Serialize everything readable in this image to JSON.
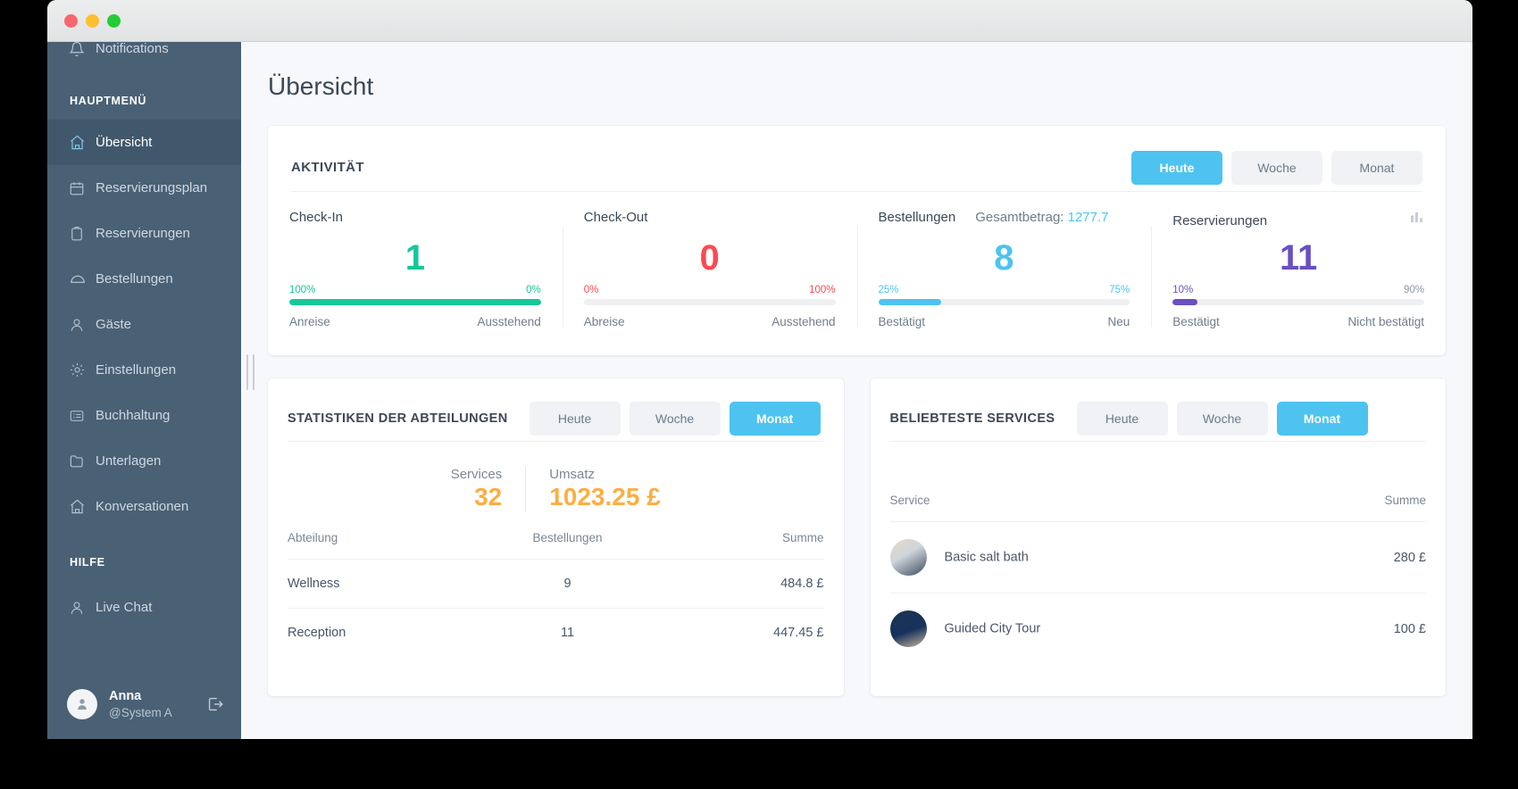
{
  "window": {
    "traffic_lights": [
      "close",
      "minimize",
      "maximize"
    ]
  },
  "sidebar": {
    "partial_item": {
      "label": "Notifications",
      "icon": "bell-icon"
    },
    "sections": [
      {
        "label": "HAUPTMENÜ",
        "items": [
          {
            "label": "Übersicht",
            "icon": "home-icon",
            "active": true
          },
          {
            "label": "Reservierungsplan",
            "icon": "calendar-icon",
            "active": false
          },
          {
            "label": "Reservierungen",
            "icon": "clipboard-icon",
            "active": false
          },
          {
            "label": "Bestellungen",
            "icon": "room-service-icon",
            "active": false
          },
          {
            "label": "Gäste",
            "icon": "user-icon",
            "active": false
          },
          {
            "label": "Einstellungen",
            "icon": "gear-icon",
            "active": false
          },
          {
            "label": "Buchhaltung",
            "icon": "list-card-icon",
            "active": false
          },
          {
            "label": "Unterlagen",
            "icon": "folder-icon",
            "active": false
          },
          {
            "label": "Konversationen",
            "icon": "home-outline-icon",
            "active": false
          }
        ]
      },
      {
        "label": "HILFE",
        "items": [
          {
            "label": "Live Chat",
            "icon": "user-icon",
            "active": false
          }
        ]
      }
    ],
    "user": {
      "name": "Anna",
      "handle": "@System A",
      "avatar_icon": "avatar-icon",
      "logout_icon": "logout-icon"
    }
  },
  "page": {
    "title": "Übersicht"
  },
  "activity": {
    "title": "AKTIVITÄT",
    "tabs": [
      {
        "label": "Heute",
        "selected": true
      },
      {
        "label": "Woche",
        "selected": false
      },
      {
        "label": "Monat",
        "selected": false
      }
    ],
    "chart_icon": "bar-chart-icon",
    "stats": [
      {
        "name": "Check-In",
        "value": "1",
        "color": "#16c79a",
        "left_pct": "100%",
        "right_pct": "0%",
        "fill": 100,
        "left_label": "Anreise",
        "right_label": "Ausstehend"
      },
      {
        "name": "Check-Out",
        "value": "0",
        "color": "#fc4a51",
        "left_pct": "0%",
        "right_pct": "100%",
        "fill": 0,
        "left_label": "Abreise",
        "right_label": "Ausstehend"
      },
      {
        "name": "Bestellungen",
        "extra_label": "Gesamtbetrag:",
        "extra_value": "1277.7",
        "value": "8",
        "color": "#4ec3f0",
        "left_pct": "25%",
        "right_pct": "75%",
        "fill": 25,
        "left_label": "Bestätigt",
        "right_label": "Neu"
      },
      {
        "name": "Reservierungen",
        "value": "11",
        "color": "#6a4fc1",
        "left_pct": "10%",
        "right_pct": "90%",
        "fill": 10,
        "left_label": "Bestätigt",
        "right_label": "Nicht bestätigt"
      }
    ]
  },
  "departments": {
    "title": "STATISTIKEN DER ABTEILUNGEN",
    "tabs": [
      {
        "label": "Heute",
        "selected": false
      },
      {
        "label": "Woche",
        "selected": false
      },
      {
        "label": "Monat",
        "selected": true
      }
    ],
    "totals": [
      {
        "caption": "Services",
        "value": "32"
      },
      {
        "caption": "Umsatz",
        "value": "1023.25 £"
      }
    ],
    "columns": [
      "Abteilung",
      "Bestellungen",
      "Summe"
    ],
    "rows": [
      {
        "department": "Wellness",
        "orders": "9",
        "sum": "484.8 £"
      },
      {
        "department": "Reception",
        "orders": "11",
        "sum": "447.45 £"
      }
    ]
  },
  "services": {
    "title": "BELIEBTESTE SERVICES",
    "tabs": [
      {
        "label": "Heute",
        "selected": false
      },
      {
        "label": "Woche",
        "selected": false
      },
      {
        "label": "Monat",
        "selected": true
      }
    ],
    "columns": [
      "Service",
      "Summe"
    ],
    "rows": [
      {
        "name": "Basic salt bath",
        "sum": "280 £",
        "thumb": "thumb-a"
      },
      {
        "name": "Guided City Tour",
        "sum": "100 £",
        "thumb": "thumb-b"
      }
    ]
  },
  "colors": {
    "accent": "#4ec3f0",
    "sidebar": "#4a6175",
    "orange": "#fbae42",
    "green": "#16c79a",
    "red": "#fc4a51",
    "purple": "#6a4fc1"
  }
}
